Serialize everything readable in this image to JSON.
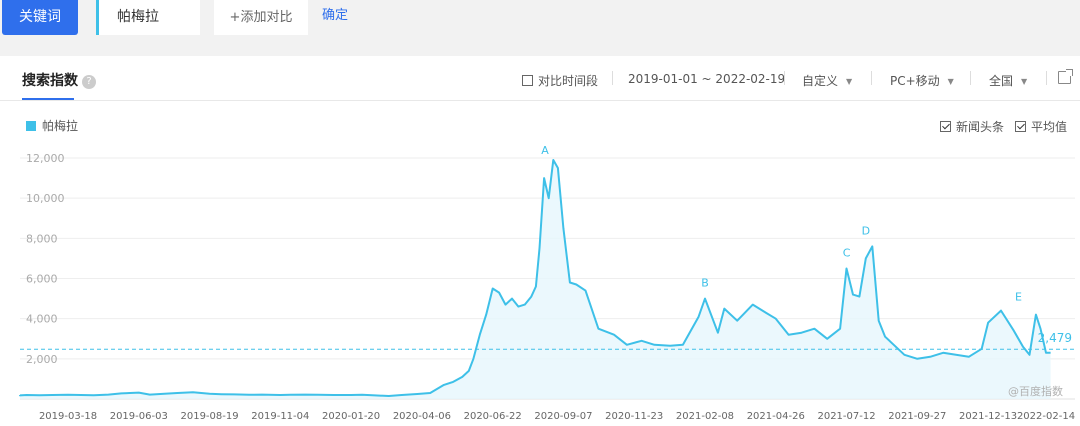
{
  "toolbar": {
    "keyword_button": "关键词",
    "keyword_value": "帕梅拉",
    "add_compare": "+添加对比",
    "confirm": "确定"
  },
  "panel": {
    "tab": "搜索指数",
    "help_icon": "question-icon",
    "compare_period": "对比时间段",
    "date_range": "2019-01-01 ~ 2022-02-19",
    "custom": "自定义",
    "device": "PC+移动",
    "region": "全国",
    "export_icon": "external-link-icon"
  },
  "legend": {
    "series_name": "帕梅拉",
    "news_headlines": "新闻头条",
    "average": "平均值"
  },
  "watermark": "@百度指数",
  "colors": {
    "line": "#3ec0e8",
    "fill": "#e6f6fc",
    "accent": "#2f6fec"
  },
  "chart_data": {
    "type": "area",
    "series": [
      {
        "name": "帕梅拉",
        "x": [
          "2019-01-01",
          "2019-01-15",
          "2019-02-01",
          "2019-02-15",
          "2019-03-01",
          "2019-03-18",
          "2019-04-01",
          "2019-04-15",
          "2019-05-01",
          "2019-05-15",
          "2019-06-03",
          "2019-06-15",
          "2019-07-01",
          "2019-07-15",
          "2019-08-01",
          "2019-08-19",
          "2019-09-01",
          "2019-09-15",
          "2019-10-01",
          "2019-10-15",
          "2019-11-04",
          "2019-11-15",
          "2019-12-01",
          "2019-12-15",
          "2020-01-01",
          "2020-01-20",
          "2020-02-01",
          "2020-02-15",
          "2020-03-01",
          "2020-03-15",
          "2020-04-01",
          "2020-04-15",
          "2020-04-30",
          "2020-05-10",
          "2020-05-20",
          "2020-05-27",
          "2020-06-01",
          "2020-06-08",
          "2020-06-15",
          "2020-06-22",
          "2020-06-29",
          "2020-07-06",
          "2020-07-13",
          "2020-07-20",
          "2020-07-27",
          "2020-08-03",
          "2020-08-08",
          "2020-08-12",
          "2020-08-17",
          "2020-08-22",
          "2020-08-27",
          "2020-09-01",
          "2020-09-07",
          "2020-09-14",
          "2020-09-21",
          "2020-10-01",
          "2020-10-15",
          "2020-11-01",
          "2020-11-15",
          "2020-12-01",
          "2020-12-15",
          "2021-01-01",
          "2021-01-15",
          "2021-02-01",
          "2021-02-08",
          "2021-02-22",
          "2021-03-01",
          "2021-03-15",
          "2021-04-01",
          "2021-04-15",
          "2021-04-26",
          "2021-05-10",
          "2021-05-24",
          "2021-06-07",
          "2021-06-21",
          "2021-07-05",
          "2021-07-12",
          "2021-07-19",
          "2021-07-26",
          "2021-08-02",
          "2021-08-09",
          "2021-08-16",
          "2021-08-23",
          "2021-08-30",
          "2021-09-06",
          "2021-09-13",
          "2021-09-27",
          "2021-10-11",
          "2021-10-25",
          "2021-11-08",
          "2021-11-22",
          "2021-12-06",
          "2021-12-13",
          "2021-12-27",
          "2022-01-10",
          "2022-01-20",
          "2022-01-27",
          "2022-02-03",
          "2022-02-08",
          "2022-02-14",
          "2022-02-19"
        ],
        "values": [
          200,
          180,
          200,
          190,
          200,
          210,
          200,
          190,
          220,
          280,
          320,
          220,
          260,
          300,
          340,
          260,
          240,
          230,
          210,
          220,
          200,
          210,
          220,
          210,
          200,
          200,
          210,
          180,
          150,
          200,
          250,
          300,
          700,
          850,
          1100,
          1400,
          2000,
          3200,
          4200,
          5500,
          5300,
          4700,
          5000,
          4600,
          4700,
          5100,
          5600,
          7500,
          11000,
          10000,
          11900,
          11500,
          8500,
          5800,
          5700,
          5400,
          3500,
          3200,
          2700,
          2900,
          2700,
          2650,
          2700,
          4100,
          5000,
          3300,
          4500,
          3900,
          4700,
          4300,
          4000,
          3200,
          3300,
          3500,
          3000,
          3500,
          6500,
          5200,
          5100,
          7000,
          7600,
          3900,
          3100,
          2800,
          2500,
          2200,
          2000,
          2100,
          2300,
          2200,
          2100,
          2500,
          3800,
          4400,
          3400,
          2600,
          2200,
          4200,
          3500,
          2300,
          2300
        ]
      }
    ],
    "xticks": [
      "2019-03-18",
      "2019-06-03",
      "2019-08-19",
      "2019-11-04",
      "2020-01-20",
      "2020-04-06",
      "2020-06-22",
      "2020-09-07",
      "2020-11-23",
      "2021-02-08",
      "2021-04-26",
      "2021-07-12",
      "2021-09-27",
      "2021-12-13",
      "2022-02-14"
    ],
    "yticks": [
      "2,000",
      "4,000",
      "6,000",
      "8,000",
      "10,000",
      "12,000"
    ],
    "ylim": [
      0,
      12000
    ],
    "average": 2479,
    "average_label": "2,479",
    "annotations": [
      {
        "label": "A",
        "date": "2020-08-18",
        "value": 11800
      },
      {
        "label": "B",
        "date": "2021-02-08",
        "value": 5200
      },
      {
        "label": "C",
        "date": "2021-07-12",
        "value": 6700
      },
      {
        "label": "D",
        "date": "2021-08-02",
        "value": 7800
      },
      {
        "label": "E",
        "date": "2022-01-15",
        "value": 4500
      }
    ],
    "grid": true,
    "legend_position": "top-left"
  }
}
